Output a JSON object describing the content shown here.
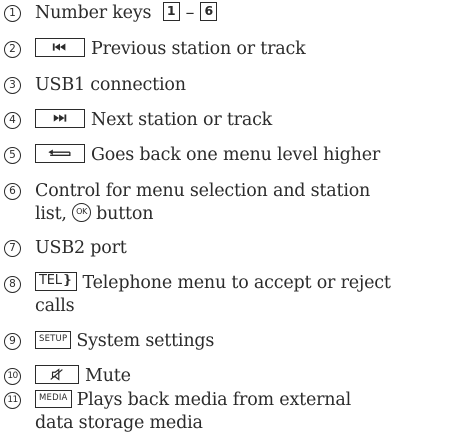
{
  "items": [
    {
      "num": "1",
      "first_key": "1",
      "dash": "–",
      "last_key": "6",
      "lines": [
        "Number keys"
      ]
    },
    {
      "num": "2",
      "icon": "skip-previous-icon",
      "lines": [
        "Previous station or track"
      ]
    },
    {
      "num": "3",
      "lines": [
        "USB1 connection"
      ]
    },
    {
      "num": "4",
      "icon": "skip-next-icon",
      "lines": [
        "Next station or track"
      ]
    },
    {
      "num": "5",
      "icon": "back-arrow-icon",
      "lines": [
        "Goes back one menu level higher"
      ]
    },
    {
      "num": "6",
      "lines": [
        "Control for menu selection and station",
        "list,",
        "button"
      ],
      "ok_label": "OK"
    },
    {
      "num": "7",
      "lines": [
        "USB2 port"
      ]
    },
    {
      "num": "8",
      "key_label": "TEL",
      "lines": [
        "Telephone menu to accept or reject",
        "calls"
      ]
    },
    {
      "num": "9",
      "key_label": "SETUP",
      "lines": [
        "System settings"
      ]
    },
    {
      "num": "10",
      "icon": "mute-icon",
      "lines": [
        "Mute"
      ]
    },
    {
      "num": "11",
      "key_label": "MEDIA",
      "lines": [
        "Plays back media from external",
        "data storage media"
      ]
    }
  ]
}
